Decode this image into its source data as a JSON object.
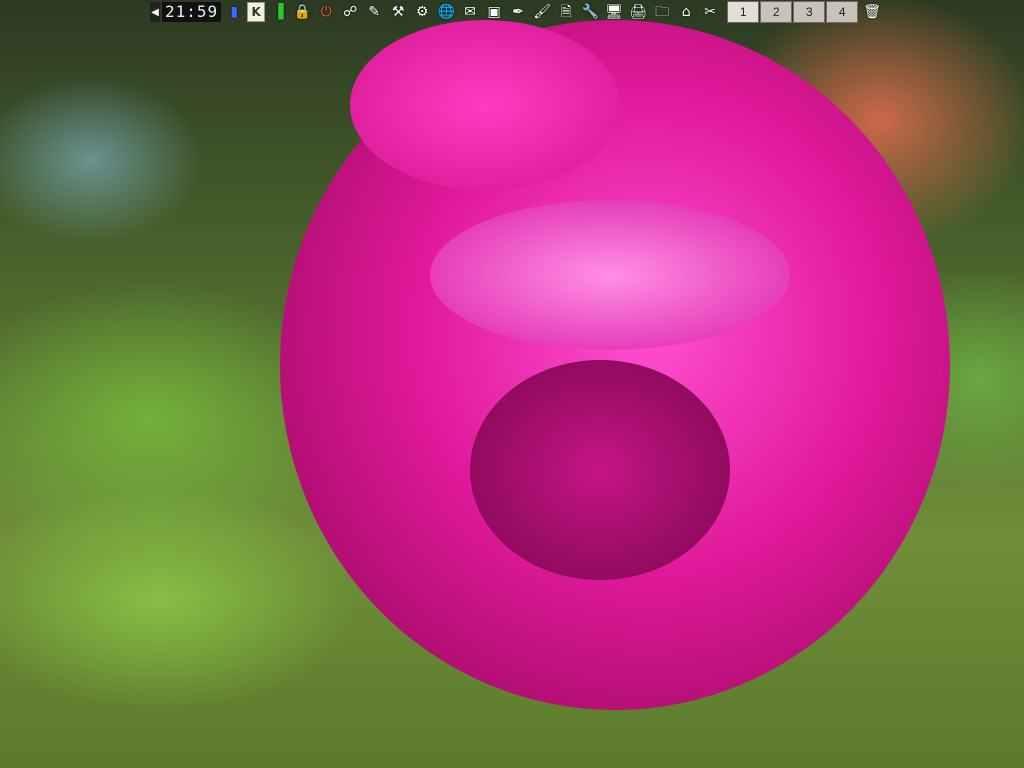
{
  "taskbar": {
    "clock": "21:59",
    "pager": [
      "1",
      "2",
      "3",
      "4"
    ],
    "k_label": "K"
  },
  "icons": [
    "arrow-left-icon",
    "clock",
    "battery-icon",
    "k-launcher-icon",
    "volume-bar-icon",
    "lock-icon",
    "power-icon",
    "network-icon",
    "tools-icon",
    "wrench-icon",
    "gear-icon",
    "globe-icon",
    "mail-icon",
    "screen-icon",
    "pen-icon",
    "brush-icon",
    "document-icon",
    "wrench2-icon",
    "monitor-icon",
    "printer-icon",
    "folder-icon",
    "home-icon",
    "settings-icon",
    "trash-icon"
  ]
}
